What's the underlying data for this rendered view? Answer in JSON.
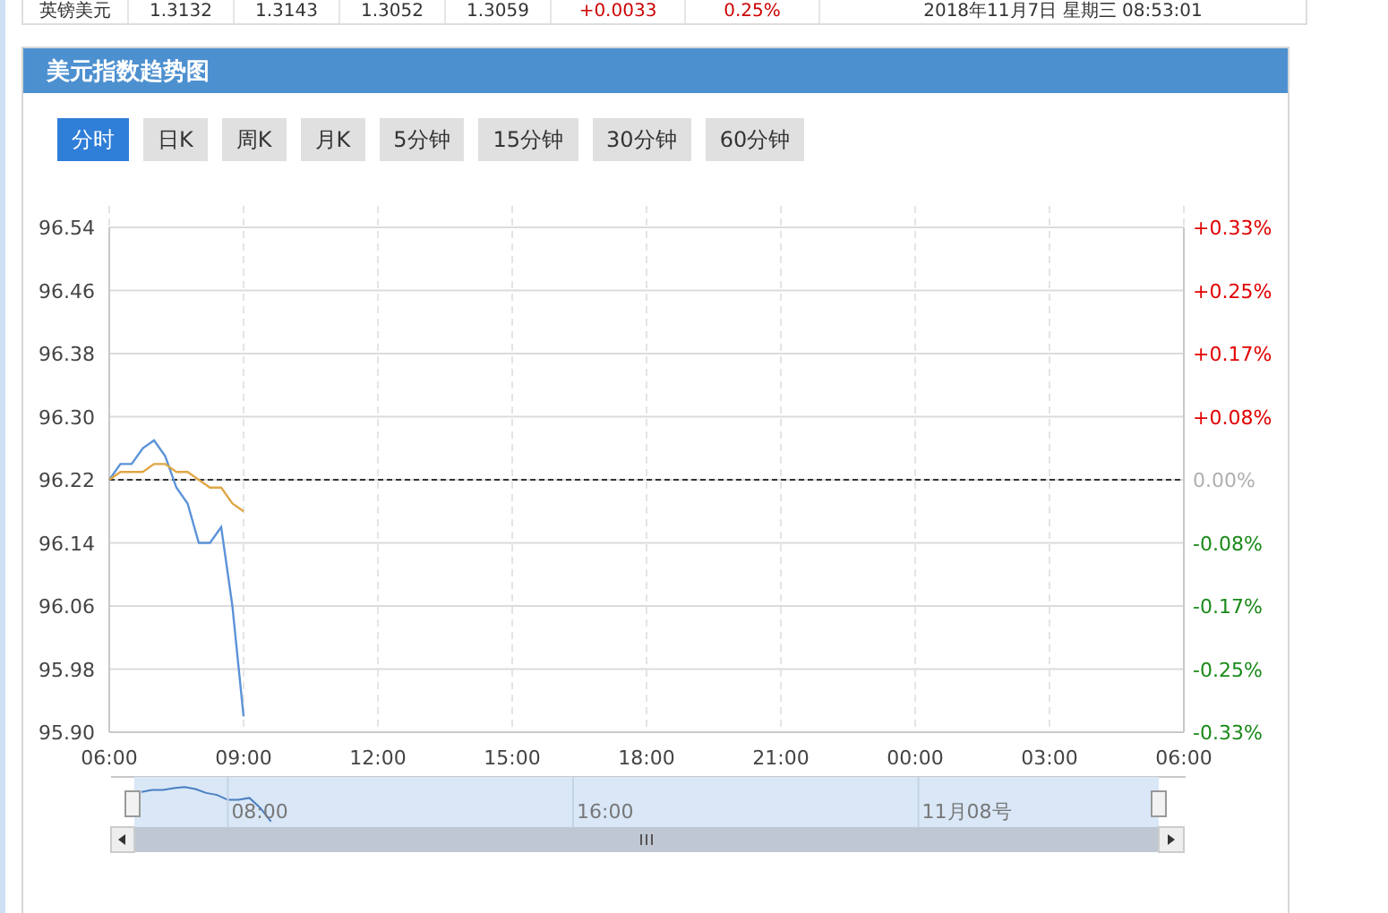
{
  "quote_row": [
    "英镑美元",
    "1.3132",
    "1.3143",
    "1.3052",
    "1.3059",
    "+0.0033",
    "0.25%",
    "2018年11月7日 星期三 08:53:01"
  ],
  "panel": {
    "title": "美元指数趋势图"
  },
  "tabs": [
    {
      "label": "分时",
      "selected": true
    },
    {
      "label": "日K",
      "selected": false
    },
    {
      "label": "周K",
      "selected": false
    },
    {
      "label": "月K",
      "selected": false
    },
    {
      "label": "5分钟",
      "selected": false
    },
    {
      "label": "15分钟",
      "selected": false
    },
    {
      "label": "30分钟",
      "selected": false
    },
    {
      "label": "60分钟",
      "selected": false
    }
  ],
  "chart_data": {
    "type": "line",
    "ylim": [
      95.9,
      96.54
    ],
    "categories": [
      "06:00",
      null,
      null,
      null,
      null,
      null,
      null,
      null,
      null,
      null,
      null,
      null,
      "09:00",
      null,
      null,
      null,
      null,
      null,
      null,
      null,
      null,
      null,
      null,
      null,
      "12:00",
      null,
      null,
      null,
      null,
      null,
      null,
      null,
      null,
      null,
      null,
      null,
      "15:00",
      null,
      null,
      null,
      null,
      null,
      null,
      null,
      null,
      null,
      null,
      null,
      "18:00",
      null,
      null,
      null,
      null,
      null,
      null,
      null,
      null,
      null,
      null,
      null,
      "21:00",
      null,
      null,
      null,
      null,
      null,
      null,
      null,
      null,
      null,
      null,
      null,
      "00:00",
      null,
      null,
      null,
      null,
      null,
      null,
      null,
      null,
      null,
      null,
      null,
      "03:00",
      null,
      null,
      null,
      null,
      null,
      null,
      null,
      null,
      null,
      null,
      null,
      "06:00"
    ],
    "yticks": [
      {
        "value": 96.54,
        "label": "96.54"
      },
      {
        "value": 96.46,
        "label": "96.46"
      },
      {
        "value": 96.38,
        "label": "96.38"
      },
      {
        "value": 96.3,
        "label": "96.30"
      },
      {
        "value": 96.22,
        "label": "96.22"
      },
      {
        "value": 96.14,
        "label": "96.14"
      },
      {
        "value": 96.06,
        "label": "96.06"
      },
      {
        "value": 95.98,
        "label": "95.98"
      },
      {
        "value": 95.9,
        "label": "95.90"
      }
    ],
    "series": [
      {
        "color": "#5b93d8",
        "values": [
          96.22,
          96.24,
          96.24,
          96.26,
          96.27,
          96.25,
          96.21,
          96.19,
          96.14,
          96.14,
          96.16,
          96.06,
          95.92,
          null,
          null,
          null,
          null,
          null,
          null,
          null,
          null,
          null,
          null,
          null,
          null,
          null,
          null,
          null,
          null,
          null,
          null,
          null,
          null,
          null,
          null,
          null,
          null,
          null,
          null,
          null,
          null,
          null,
          null,
          null,
          null,
          null,
          null,
          null,
          null,
          null,
          null,
          null,
          null,
          null,
          null,
          null,
          null,
          null,
          null,
          null,
          null,
          null,
          null,
          null,
          null,
          null,
          null,
          null,
          null,
          null,
          null,
          null,
          null,
          null,
          null,
          null,
          null,
          null,
          null,
          null,
          null,
          null,
          null,
          null,
          null,
          null,
          null,
          null,
          null,
          null,
          null,
          null,
          null,
          null,
          null,
          null,
          null
        ]
      },
      {
        "color": "#e0a646",
        "values": [
          96.22,
          96.23,
          96.23,
          96.23,
          96.24,
          96.24,
          96.23,
          96.23,
          96.22,
          96.21,
          96.21,
          96.19,
          96.18,
          null,
          null,
          null,
          null,
          null,
          null,
          null,
          null,
          null,
          null,
          null,
          null,
          null,
          null,
          null,
          null,
          null,
          null,
          null,
          null,
          null,
          null,
          null,
          null,
          null,
          null,
          null,
          null,
          null,
          null,
          null,
          null,
          null,
          null,
          null,
          null,
          null,
          null,
          null,
          null,
          null,
          null,
          null,
          null,
          null,
          null,
          null,
          null,
          null,
          null,
          null,
          null,
          null,
          null,
          null,
          null,
          null,
          null,
          null,
          null,
          null,
          null,
          null,
          null,
          null,
          null,
          null,
          null,
          null,
          null,
          null,
          null,
          null,
          null,
          null,
          null,
          null,
          null,
          null,
          null,
          null,
          null,
          null,
          null
        ]
      }
    ],
    "grid": true,
    "ref_lines": [
      {
        "axis": "y",
        "value": 96.22
      }
    ]
  },
  "right_axis": [
    {
      "label": "+0.33%",
      "color": "#e00000"
    },
    {
      "label": "+0.25%",
      "color": "#e00000"
    },
    {
      "label": "+0.17%",
      "color": "#e00000"
    },
    {
      "label": "+0.08%",
      "color": "#e00000"
    },
    {
      "label": "0.00%",
      "color": "#b0b0b0"
    },
    {
      "label": "-0.08%",
      "color": "#1a8a1a"
    },
    {
      "label": "-0.17%",
      "color": "#1a8a1a"
    },
    {
      "label": "-0.25%",
      "color": "#1a8a1a"
    },
    {
      "label": "-0.33%",
      "color": "#1a8a1a"
    }
  ],
  "navigator": {
    "labels": [
      "08:00",
      "16:00",
      "11月08号"
    ]
  }
}
